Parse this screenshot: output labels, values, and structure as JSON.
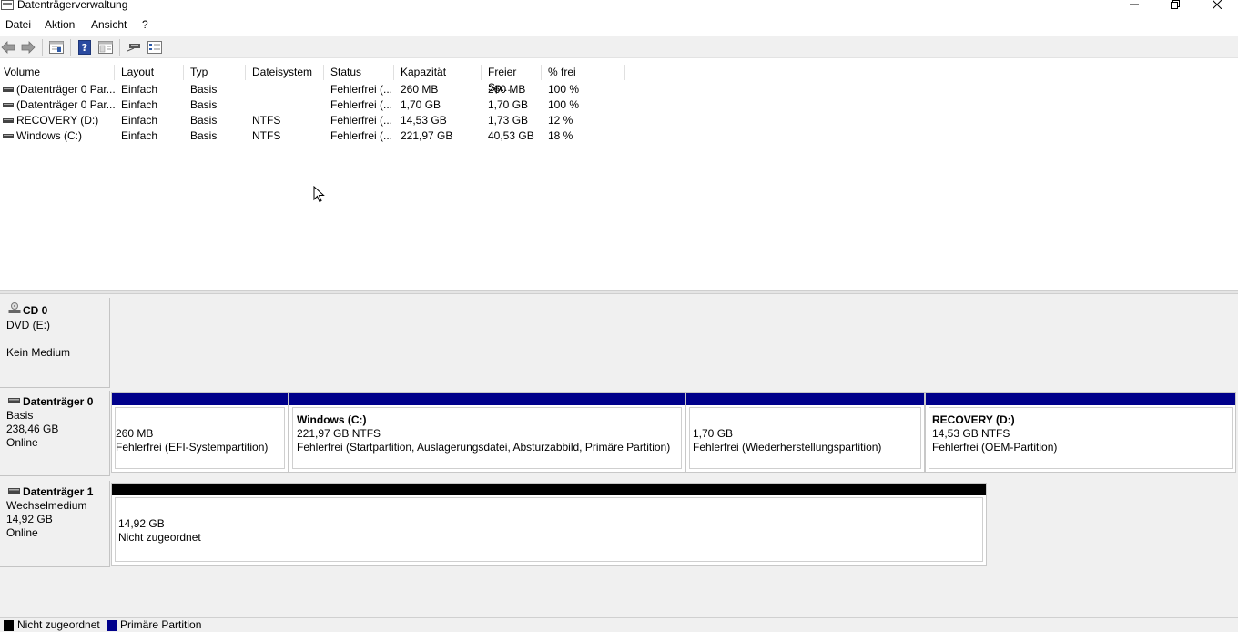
{
  "window": {
    "title": "Datenträgerverwaltung"
  },
  "menu": {
    "items": [
      "Datei",
      "Aktion",
      "Ansicht",
      "?"
    ]
  },
  "toolbar": {
    "icons": [
      "back-arrow-icon",
      "forward-arrow-icon",
      "disk-list-icon",
      "help-icon",
      "properties-icon",
      "connect-icon",
      "settings-icon"
    ]
  },
  "volume_list": {
    "columns": [
      "Volume",
      "Layout",
      "Typ",
      "Dateisystem",
      "Status",
      "Kapazität",
      "Freier Sp...",
      "% frei"
    ],
    "rows": [
      {
        "volume": "(Datenträger 0 Par...",
        "layout": "Einfach",
        "typ": "Basis",
        "fs": "",
        "status": "Fehlerfrei (...",
        "capacity": "260 MB",
        "free": "260 MB",
        "pct": "100 %"
      },
      {
        "volume": "(Datenträger 0 Par...",
        "layout": "Einfach",
        "typ": "Basis",
        "fs": "",
        "status": "Fehlerfrei (...",
        "capacity": "1,70 GB",
        "free": "1,70 GB",
        "pct": "100 %"
      },
      {
        "volume": "RECOVERY (D:)",
        "layout": "Einfach",
        "typ": "Basis",
        "fs": "NTFS",
        "status": "Fehlerfrei (...",
        "capacity": "14,53 GB",
        "free": "1,73 GB",
        "pct": "12 %"
      },
      {
        "volume": "Windows (C:)",
        "layout": "Einfach",
        "typ": "Basis",
        "fs": "NTFS",
        "status": "Fehlerfrei (...",
        "capacity": "221,97 GB",
        "free": "40,53 GB",
        "pct": "18 %"
      }
    ]
  },
  "disks": {
    "cd0": {
      "name": "CD 0",
      "line1": "DVD (E:)",
      "line2": "Kein Medium"
    },
    "disk0": {
      "name": "Datenträger 0",
      "type": "Basis",
      "size": "238,46 GB",
      "state": "Online",
      "partitions": [
        {
          "title": "",
          "size": "260 MB",
          "status": "Fehlerfrei (EFI-Systempartition)"
        },
        {
          "title": "Windows  (C:)",
          "size": "221,97 GB NTFS",
          "status": "Fehlerfrei (Startpartition, Auslagerungsdatei, Absturzabbild, Primäre Partition)"
        },
        {
          "title": "",
          "size": "1,70 GB",
          "status": "Fehlerfrei (Wiederherstellungspartition)"
        },
        {
          "title": "RECOVERY  (D:)",
          "size": "14,53 GB NTFS",
          "status": "Fehlerfrei (OEM-Partition)"
        }
      ]
    },
    "disk1": {
      "name": "Datenträger 1",
      "type": "Wechselmedium",
      "size": "14,92 GB",
      "state": "Online",
      "partitions": [
        {
          "size": "14,92 GB",
          "status": "Nicht zugeordnet"
        }
      ]
    }
  },
  "legend": {
    "items": [
      {
        "label": "Nicht zugeordnet",
        "color": "#000000"
      },
      {
        "label": "Primäre Partition",
        "color": "#00008b"
      }
    ]
  },
  "colors": {
    "primary_partition": "#00008b",
    "unallocated": "#000000"
  }
}
